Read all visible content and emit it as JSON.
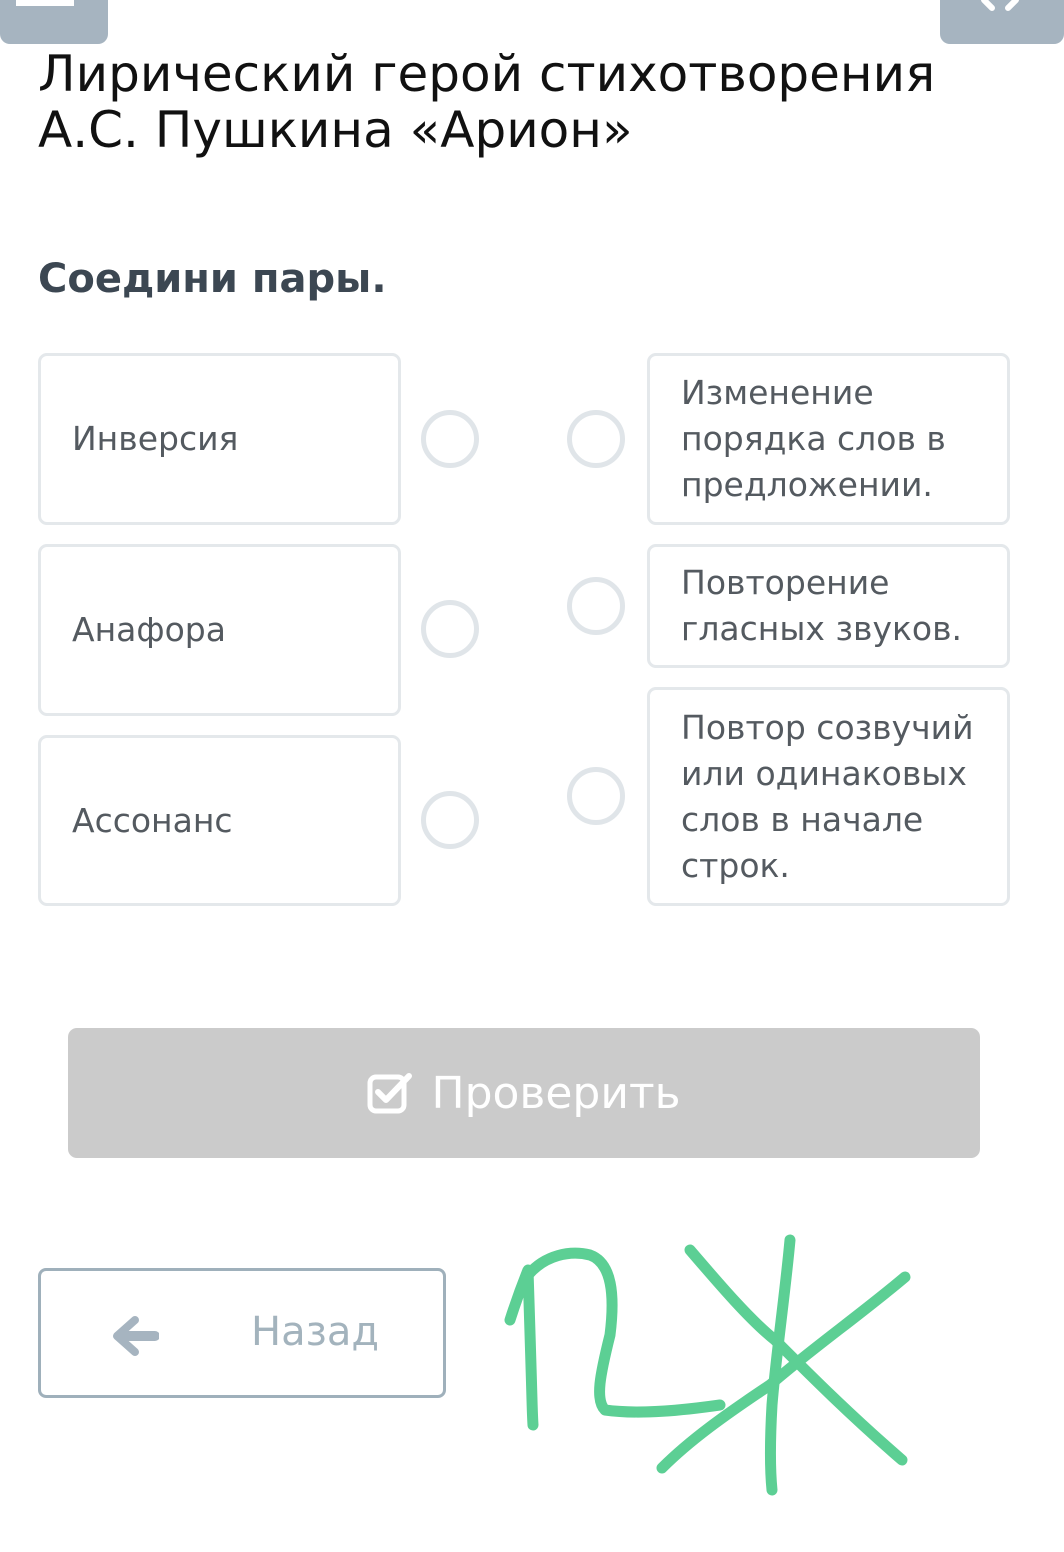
{
  "title": "Лирический герой стихотворения А.С. Пушкина «Арион»",
  "instruction": "Соедини пары.",
  "left_items": [
    {
      "label": "Инверсия"
    },
    {
      "label": "Анафора"
    },
    {
      "label": "Ассонанс"
    }
  ],
  "right_items": [
    {
      "label": "Изменение порядка слов в предложении."
    },
    {
      "label": "Повторение гласных звуков."
    },
    {
      "label": "Повтор созвучий или одинаковых слов в начале строк."
    }
  ],
  "check_button": {
    "label": "Проверить",
    "icon": "checkbox-check-icon"
  },
  "back_button": {
    "label": "Назад",
    "icon": "arrow-left-icon"
  },
  "colors": {
    "card_border": "#e4e8eb",
    "card_text": "#545a60",
    "check_button_bg": "#cbcbcb",
    "back_border": "#9fb0bb",
    "handwriting": "#5ccf94",
    "top_tab": "#a6b4c0"
  }
}
